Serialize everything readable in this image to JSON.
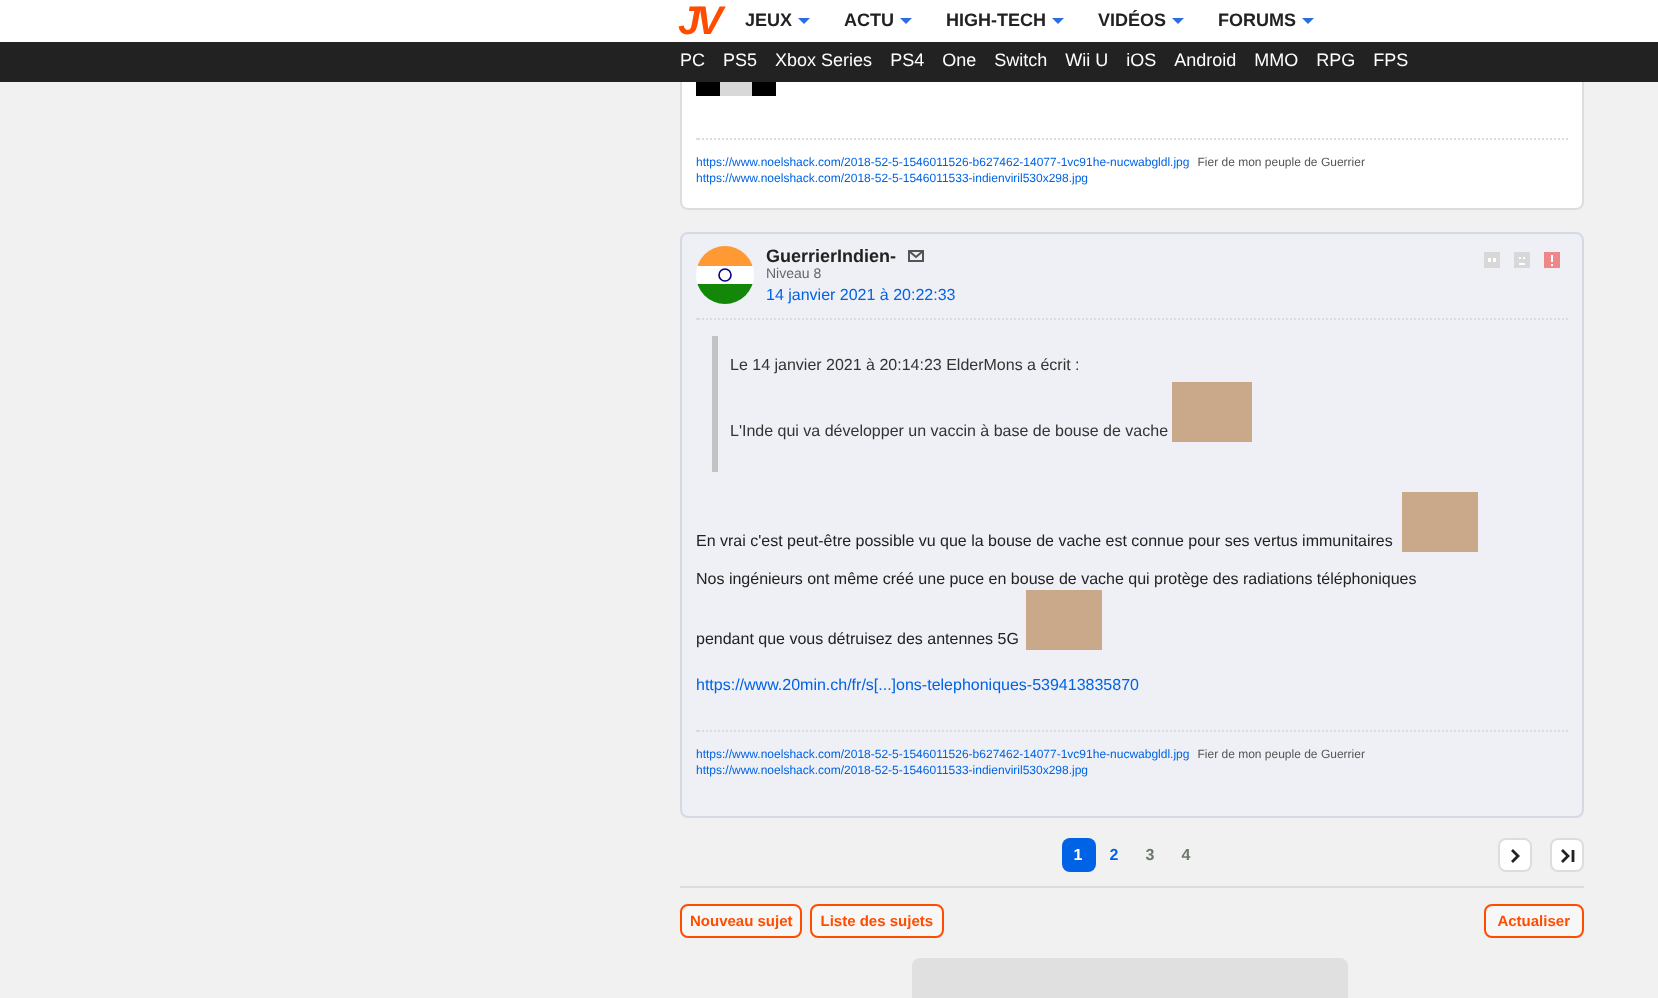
{
  "header": {
    "logo": "JV",
    "menu": [
      {
        "label": "JEUX"
      },
      {
        "label": "ACTU"
      },
      {
        "label": "HIGH-TECH"
      },
      {
        "label": "VIDÉOS"
      },
      {
        "label": "FORUMS"
      }
    ]
  },
  "platforms": [
    "PC",
    "PS5",
    "Xbox Series",
    "PS4",
    "One",
    "Switch",
    "Wii U",
    "iOS",
    "Android",
    "MMO",
    "RPG",
    "FPS"
  ],
  "previous_post": {
    "signature": [
      {
        "link": "https://www.noelshack.com/2018-52-5-1546011526-b627462-14077-1vc91he-nucwabgldl.jpg",
        "text": "Fier de mon peuple de Guerrier"
      },
      {
        "link": "https://www.noelshack.com/2018-52-5-1546011533-indienviril530x298.jpg"
      }
    ]
  },
  "post": {
    "author": "GuerrierIndien-",
    "level": "Niveau 8",
    "date": "14 janvier 2021 à 20:22:33",
    "quote": {
      "header": "Le 14 janvier 2021 à 20:14:23 ElderMons a écrit :",
      "text": "L'Inde qui va développer un vaccin à base de bouse de vache"
    },
    "paragraphs": [
      "En vrai c'est peut-être possible vu que la bouse de vache est connue pour ses vertus immunitaires",
      "Nos ingénieurs ont même créé une puce en bouse de vache qui protège des radiations téléphoniques",
      "pendant que vous détruisez des antennes 5G"
    ],
    "link": "https://www.20min.ch/fr/s[...]ons-telephoniques-539413835870",
    "signature": [
      {
        "link": "https://www.noelshack.com/2018-52-5-1546011526-b627462-14077-1vc91he-nucwabgldl.jpg",
        "text": "Fier de mon peuple de Guerrier"
      },
      {
        "link": "https://www.noelshack.com/2018-52-5-1546011533-indienviril530x298.jpg"
      }
    ]
  },
  "pagination": [
    {
      "label": "1",
      "selected": true,
      "color": "#0063e5"
    },
    {
      "label": "2",
      "selected": false,
      "color": "#0063e5"
    },
    {
      "label": "3",
      "selected": false,
      "color": "#6b7a6b"
    },
    {
      "label": "4",
      "selected": false,
      "color": "#6b7a6b"
    }
  ],
  "buttons_left": [
    "Nouveau sujet",
    "Liste des sujets"
  ],
  "button_right": "Actualiser"
}
